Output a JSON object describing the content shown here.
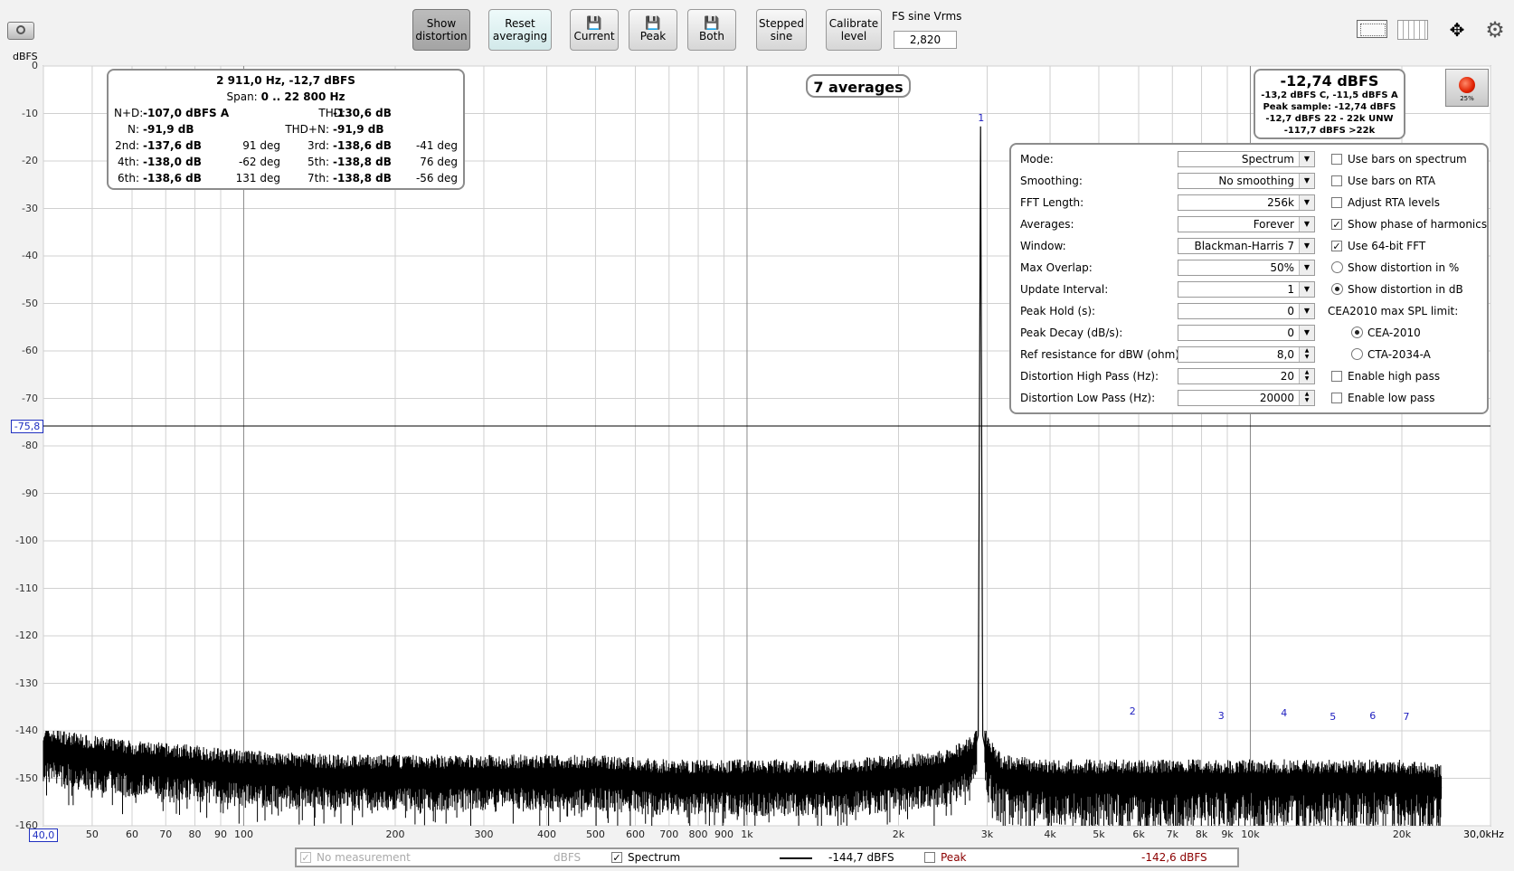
{
  "toolbar": {
    "show_distortion": [
      "Show",
      "distortion"
    ],
    "reset_averaging": [
      "Reset",
      "averaging"
    ],
    "current": "Current",
    "peak": "Peak",
    "both": "Both",
    "stepped_sine": [
      "Stepped",
      "sine"
    ],
    "calibrate_level": [
      "Calibrate",
      "level"
    ],
    "fs_sine_label": "FS sine Vrms",
    "fs_sine_value": "2,820"
  },
  "plot": {
    "unit_label": "dBFS",
    "y_ticks": [
      "0",
      "-10",
      "-20",
      "-30",
      "-40",
      "-50",
      "-60",
      "-70",
      "-80",
      "-90",
      "-100",
      "-110",
      "-120",
      "-130",
      "-140",
      "-150",
      "-160"
    ],
    "cursor_value": "-75,8",
    "x_start": "40,0",
    "x_end": "30,0kHz",
    "x_ticks": [
      "50",
      "60",
      "70",
      "80",
      "90",
      "100",
      "200",
      "300",
      "400",
      "500",
      "600",
      "700",
      "800",
      "900",
      "1k",
      "2k",
      "3k",
      "4k",
      "5k",
      "6k",
      "7k",
      "8k",
      "9k",
      "10k",
      "20k"
    ],
    "averages_label": "7 averages",
    "harmonic_markers": [
      "1",
      "2",
      "3",
      "4",
      "5",
      "6",
      "7"
    ]
  },
  "distortion": {
    "title": "2 911,0 Hz, -12,7 dBFS",
    "span_label": "Span:",
    "span_value": "0 .. 22 800 Hz",
    "nd_label": "N+D:",
    "nd_value": "-107,0 dBFS A",
    "thd_label": "THD:",
    "thd_value": "-130,6 dB",
    "n_label": "N:",
    "n_value": "-91,9 dB",
    "thdn_label": "THD+N:",
    "thdn_value": "-91,9 dB",
    "h2_label": "2nd:",
    "h2_value": "-137,6 dB",
    "h2_phase": "91 deg",
    "h3_label": "3rd:",
    "h3_value": "-138,6 dB",
    "h3_phase": "-41 deg",
    "h4_label": "4th:",
    "h4_value": "-138,0 dB",
    "h4_phase": "-62 deg",
    "h5_label": "5th:",
    "h5_value": "-138,8 dB",
    "h5_phase": "76 deg",
    "h6_label": "6th:",
    "h6_value": "-138,6 dB",
    "h6_phase": "131 deg",
    "h7_label": "7th:",
    "h7_value": "-138,8 dB",
    "h7_phase": "-56 deg"
  },
  "level": {
    "main": "-12,74 dBFS",
    "line1": "-13,2 dBFS C, -11,5 dBFS A",
    "line2": "Peak sample: -12,74 dBFS",
    "line3": "-12,7 dBFS 22 - 22k UNW",
    "line4": "-117,7 dBFS >22k",
    "record_percent": "25%"
  },
  "settings": {
    "mode_label": "Mode:",
    "mode_value": "Spectrum",
    "smoothing_label": "Smoothing:",
    "smoothing_value": "No  smoothing",
    "fft_label": "FFT Length:",
    "fft_value": "256k",
    "averages_label": "Averages:",
    "averages_value": "Forever",
    "window_label": "Window:",
    "window_value": "Blackman-Harris 7",
    "overlap_label": "Max Overlap:",
    "overlap_value": "50%",
    "update_label": "Update Interval:",
    "update_value": "1",
    "peakhold_label": "Peak Hold (s):",
    "peakhold_value": "0",
    "peakdecay_label": "Peak Decay (dB/s):",
    "peakdecay_value": "0",
    "refres_label": "Ref resistance for dBW (ohm):",
    "refres_value": "8,0",
    "hp_label": "Distortion High Pass (Hz):",
    "hp_value": "20",
    "lp_label": "Distortion Low Pass (Hz):",
    "lp_value": "20000",
    "opt_bars_spectrum": "Use bars on spectrum",
    "opt_bars_rta": "Use bars on RTA",
    "opt_adjust_rta": "Adjust RTA levels",
    "opt_show_phase": "Show phase of harmonics",
    "opt_64bit": "Use 64-bit FFT",
    "opt_dist_pct": "Show distortion in %",
    "opt_dist_db": "Show distortion in dB",
    "cea_label": "CEA2010 max SPL limit:",
    "cea2010": "CEA-2010",
    "cta2034": "CTA-2034-A",
    "opt_high_pass": "Enable high pass",
    "opt_low_pass": "Enable low pass"
  },
  "legend": {
    "no_measurement": "No measurement",
    "no_measurement_unit": "dBFS",
    "spectrum": "Spectrum",
    "spectrum_value": "-144,7 dBFS",
    "peak": "Peak",
    "peak_value": "-142,6 dBFS"
  },
  "chart_data": {
    "type": "line",
    "xlabel": "",
    "ylabel": "dBFS",
    "xlim": [
      40,
      30000
    ],
    "ylim": [
      -160,
      0
    ],
    "x_scale": "log",
    "grid": true,
    "series": [
      {
        "name": "Spectrum",
        "x": [
          40,
          50,
          60,
          80,
          100,
          150,
          200,
          300,
          500,
          700,
          1000,
          1500,
          2000,
          2500,
          2800,
          2880,
          2911,
          2940,
          3000,
          3200,
          4000,
          6000,
          8000,
          10000,
          15000,
          20000,
          24000
        ],
        "y": [
          -144,
          -146,
          -147,
          -148,
          -149,
          -150,
          -150,
          -150,
          -150,
          -151,
          -151,
          -151,
          -150,
          -149,
          -146,
          -141,
          -12.7,
          -141,
          -146,
          -150,
          -151,
          -151,
          -151,
          -151,
          -151,
          -151,
          -152
        ]
      }
    ],
    "harmonics": [
      {
        "label": "1",
        "x": 2911,
        "y": -12.7
      },
      {
        "label": "2",
        "x": 5822,
        "y": -137.6
      },
      {
        "label": "3",
        "x": 8733,
        "y": -138.6
      },
      {
        "label": "4",
        "x": 11644,
        "y": -138.0
      },
      {
        "label": "5",
        "x": 14555,
        "y": -138.8
      },
      {
        "label": "6",
        "x": 17466,
        "y": -138.6
      },
      {
        "label": "7",
        "x": 20377,
        "y": -138.8
      }
    ]
  }
}
